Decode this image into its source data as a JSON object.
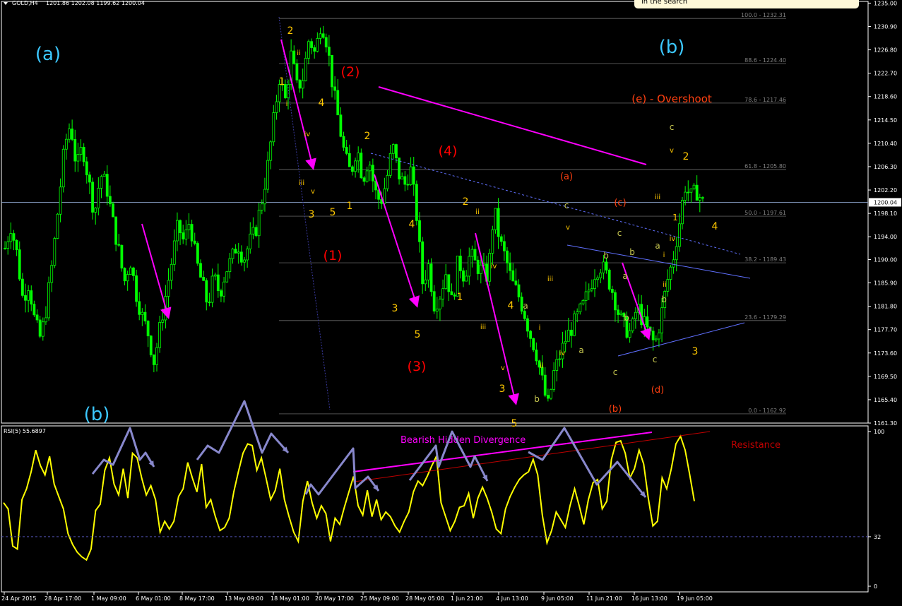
{
  "header": {
    "symbol_label": "GOLD,H4",
    "ohlc": "1201.86 1202.08 1199.62 1200.04",
    "rsi_label": "RSI(5) 55.6897",
    "note_text": "in the search"
  },
  "colors": {
    "candle": "#00ff00",
    "rsi_line": "#ffff00",
    "magenta": "#ff00ff",
    "fib": "#808080",
    "channel": "#6070ff",
    "wave_yellow": "#ffc800",
    "wave_red": "#ff0000",
    "wave_orange": "#ff4010",
    "wave_cyan": "#3cc8ff",
    "divergence_arrows": "#8888cc",
    "resistance": "#c00000"
  },
  "chart_data": [
    {
      "type": "candlestick",
      "title": "GOLD,H4",
      "ohlc_last": {
        "open": 1201.86,
        "high": 1202.08,
        "low": 1199.62,
        "close": 1200.04
      },
      "ylim": [
        1161.3,
        1235.3
      ],
      "y_ticks": [
        "1235.00",
        "1230.90",
        "1226.80",
        "1222.70",
        "1218.60",
        "1214.50",
        "1210.40",
        "1206.30",
        "1202.20",
        "1198.10",
        "1194.00",
        "1190.00",
        "1185.90",
        "1181.80",
        "1177.70",
        "1173.60",
        "1169.50",
        "1165.40",
        "1161.30"
      ],
      "x_ticks": [
        "24 Apr 2015",
        "28 Apr 17:00",
        "1 May 09:00",
        "6 May 01:00",
        "8 May 17:00",
        "13 May 09:00",
        "18 May 01:00",
        "20 May 17:00",
        "25 May 09:00",
        "28 May 05:00",
        "1 Jun 21:00",
        "4 Jun 13:00",
        "9 Jun 05:00",
        "11 Jun 21:00",
        "16 Jun 13:00",
        "19 Jun 05:00"
      ],
      "current_price": "1200.04",
      "fib_levels": [
        {
          "label": "100.0 - 1232.31",
          "value": 1232.31
        },
        {
          "label": "88.6 - 1224.40",
          "value": 1224.4
        },
        {
          "label": "78.6 - 1217.46",
          "value": 1217.46
        },
        {
          "label": "61.8 - 1205.80",
          "value": 1205.8
        },
        {
          "label": "50.0 - 1197.61",
          "value": 1197.61
        },
        {
          "label": "38.2 - 1189.43",
          "value": 1189.43
        },
        {
          "label": "23.6 - 1179.29",
          "value": 1179.29
        },
        {
          "label": "0.0 - 1162.92",
          "value": 1162.92
        }
      ],
      "price_path": [
        1192,
        1196,
        1191,
        1183,
        1186,
        1179,
        1176,
        1182,
        1190,
        1200,
        1210,
        1214,
        1206,
        1210,
        1204,
        1198,
        1205,
        1203,
        1197,
        1192,
        1186,
        1190,
        1184,
        1180,
        1177,
        1172,
        1178,
        1184,
        1190,
        1196,
        1193,
        1197,
        1190,
        1186,
        1182,
        1187,
        1184,
        1188,
        1190,
        1193,
        1190,
        1193,
        1195,
        1200,
        1206,
        1214,
        1222,
        1218,
        1226,
        1220,
        1222,
        1229,
        1226,
        1232,
        1228,
        1220,
        1214,
        1208,
        1205,
        1210,
        1204,
        1208,
        1202,
        1200,
        1204,
        1210,
        1205,
        1203,
        1206,
        1198,
        1186,
        1189,
        1182,
        1184,
        1188,
        1182,
        1190,
        1187,
        1191,
        1189,
        1188,
        1187,
        1199,
        1193,
        1190,
        1186,
        1184,
        1181,
        1177,
        1174,
        1169,
        1164,
        1170,
        1173,
        1176,
        1178,
        1180,
        1182,
        1185,
        1188,
        1189,
        1187,
        1184,
        1180,
        1178,
        1177,
        1182,
        1179,
        1177,
        1175,
        1180,
        1186,
        1190,
        1196,
        1203,
        1201,
        1202,
        1200
      ]
    },
    {
      "type": "line",
      "title": "RSI(5) 55.6897",
      "ylim": [
        0,
        100
      ],
      "y_ticks": [
        "100",
        "32",
        "0"
      ],
      "series": [
        {
          "values": [
            54,
            50,
            26,
            24,
            56,
            63,
            74,
            88,
            78,
            72,
            84,
            66,
            58,
            50,
            34,
            27,
            22,
            19,
            17,
            24,
            49,
            53,
            75,
            83,
            66,
            59,
            76,
            57,
            86,
            83,
            70,
            59,
            65,
            56,
            35,
            42,
            37,
            42,
            58,
            63,
            80,
            70,
            61,
            79,
            51,
            56,
            45,
            36,
            38,
            44,
            61,
            74,
            86,
            92,
            91,
            75,
            83,
            70,
            56,
            62,
            76,
            56,
            45,
            35,
            29,
            55,
            68,
            54,
            44,
            52,
            47,
            29,
            44,
            40,
            51,
            61,
            71,
            52,
            46,
            62,
            45,
            56,
            43,
            48,
            45,
            39,
            35,
            42,
            48,
            61,
            68,
            65,
            71,
            78,
            84,
            54,
            45,
            36,
            42,
            51,
            52,
            60,
            44,
            57,
            64,
            57,
            48,
            37,
            34,
            50,
            58,
            64,
            69,
            72,
            74,
            82,
            72,
            46,
            28,
            36,
            48,
            43,
            38,
            52,
            63,
            52,
            40,
            56,
            67,
            69,
            50,
            55,
            82,
            93,
            94,
            86,
            70,
            76,
            88,
            79,
            57,
            39,
            42,
            70,
            63,
            76,
            92,
            97,
            88,
            72,
            55
          ]
        }
      ]
    }
  ],
  "wave_labels": [
    {
      "text": "(a)",
      "color": "wave_cyan",
      "price": 1226
    },
    {
      "text": "(b)",
      "color": "wave_cyan",
      "price": 1227
    },
    {
      "text": "(b)",
      "color": "wave_cyan",
      "price": 1162
    },
    {
      "text": "(1)",
      "color": "wave_red",
      "price": 1192
    },
    {
      "text": "(2)",
      "color": "wave_red",
      "price": 1222
    },
    {
      "text": "(3)",
      "color": "wave_red",
      "price": 1171
    },
    {
      "text": "(4)",
      "color": "wave_red",
      "price": 1209
    },
    {
      "text": "(e) -  Overshoot",
      "color": "wave_orange",
      "price": 1217
    },
    {
      "text": "(a)",
      "color": "wave_orange",
      "price": 1204
    },
    {
      "text": "(c)",
      "color": "wave_orange",
      "price": 1200
    },
    {
      "text": "(d)",
      "color": "wave_orange",
      "price": 1168
    },
    {
      "text": "(b)",
      "color": "wave_orange",
      "price": 1164
    },
    {
      "text": "1",
      "color": "wave_yellow"
    },
    {
      "text": "2",
      "color": "wave_yellow"
    },
    {
      "text": "3",
      "color": "wave_yellow"
    },
    {
      "text": "4",
      "color": "wave_yellow"
    },
    {
      "text": "5",
      "color": "wave_yellow"
    },
    {
      "text": "i",
      "color": "wave_yellow"
    },
    {
      "text": "ii",
      "color": "wave_yellow"
    },
    {
      "text": "iii",
      "color": "wave_yellow"
    },
    {
      "text": "iv",
      "color": "wave_yellow"
    },
    {
      "text": "v",
      "color": "wave_yellow"
    },
    {
      "text": "a",
      "color": "wave_yellow"
    },
    {
      "text": "b",
      "color": "wave_yellow"
    },
    {
      "text": "c",
      "color": "wave_yellow"
    }
  ],
  "rsi_annotations": {
    "divergence": "Bearish Hidden Divergence",
    "resistance": "Resistance"
  }
}
